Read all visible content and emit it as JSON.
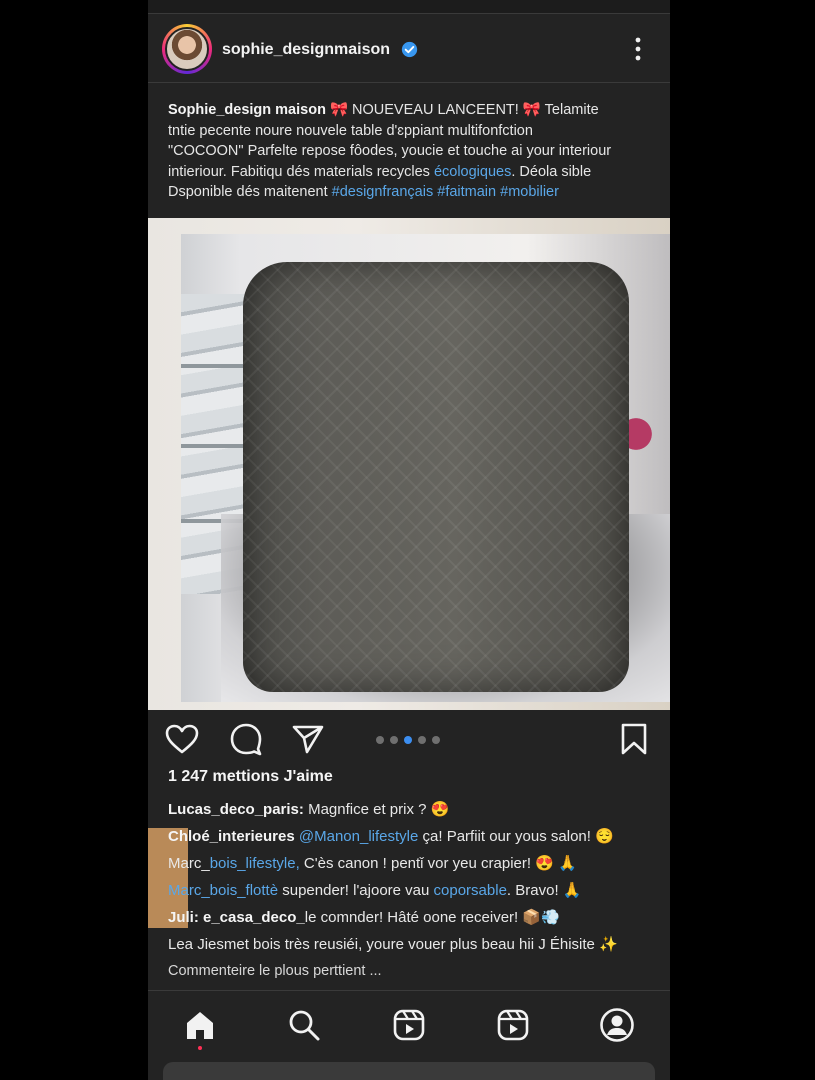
{
  "post": {
    "username": "sophie_designmaison",
    "caption": {
      "author": "Sophie_design maison",
      "title": "🎀 NOUEVEAU LANCEENT! 🎀 Telamite",
      "line2": "tntie pecente noure nouvele table d'ɛppiant multifonfction",
      "line3": "\"COCOON\" Parfelte repose fôodes, youcie et touche ai your interiour",
      "line4": "intieriour. Fabitiqu dés materials recycles ",
      "line4_tag": "écologiques",
      "line4_end": ". Déola sible",
      "line5": "Dsponible dés maitenent ",
      "hashtags": [
        "#designfrançais",
        "#faitmain",
        "#mobilier"
      ]
    },
    "likes_text": "1 247 mettions J'aime",
    "carousel": {
      "count": 5,
      "active_index": 2
    },
    "comments": [
      {
        "user": "Lucas_deco_paris:",
        "text": " Magnfice et prix ? 😍"
      },
      {
        "user": "Chloé_interieures",
        "mention": " @Manon_lifestyle",
        "text": " ça! Parfiit our yous salon! 😌"
      },
      {
        "user": "Marc_",
        "user_link": "bois_lifestyle,",
        "text": " C'ès canon ! pentǐ vor yeu crapier! 😍 🙏"
      },
      {
        "user_link_full": "Marc_bois_flottè",
        "text": " supender! l'ajoore vau ",
        "text_link": "coporsable",
        "text_end": ". Bravo! 🙏"
      },
      {
        "user": "Juli: e_casa_deco_",
        "text": "le comnder! Hâté oone receiver! 📦💨"
      },
      {
        "text": "Lea Jiesmet bois très reusiéi, youre vouer plus beau hii J Éhisite ✨"
      }
    ],
    "more_comments": "Commenteire le plous perttient ..."
  },
  "icons": {
    "verified": "verified-badge-icon",
    "more": "more-vertical-icon",
    "like": "heart-icon",
    "comment": "comment-icon",
    "share": "send-icon",
    "save": "bookmark-icon"
  },
  "navbar": {
    "items": [
      "home-icon",
      "search-icon",
      "reels-icon",
      "reels-icon",
      "profile-icon"
    ]
  },
  "colors": {
    "background": "#232323",
    "link": "#5aa7e8",
    "active_dot": "#3c8ef0",
    "notification_dot": "#ff2f55"
  }
}
